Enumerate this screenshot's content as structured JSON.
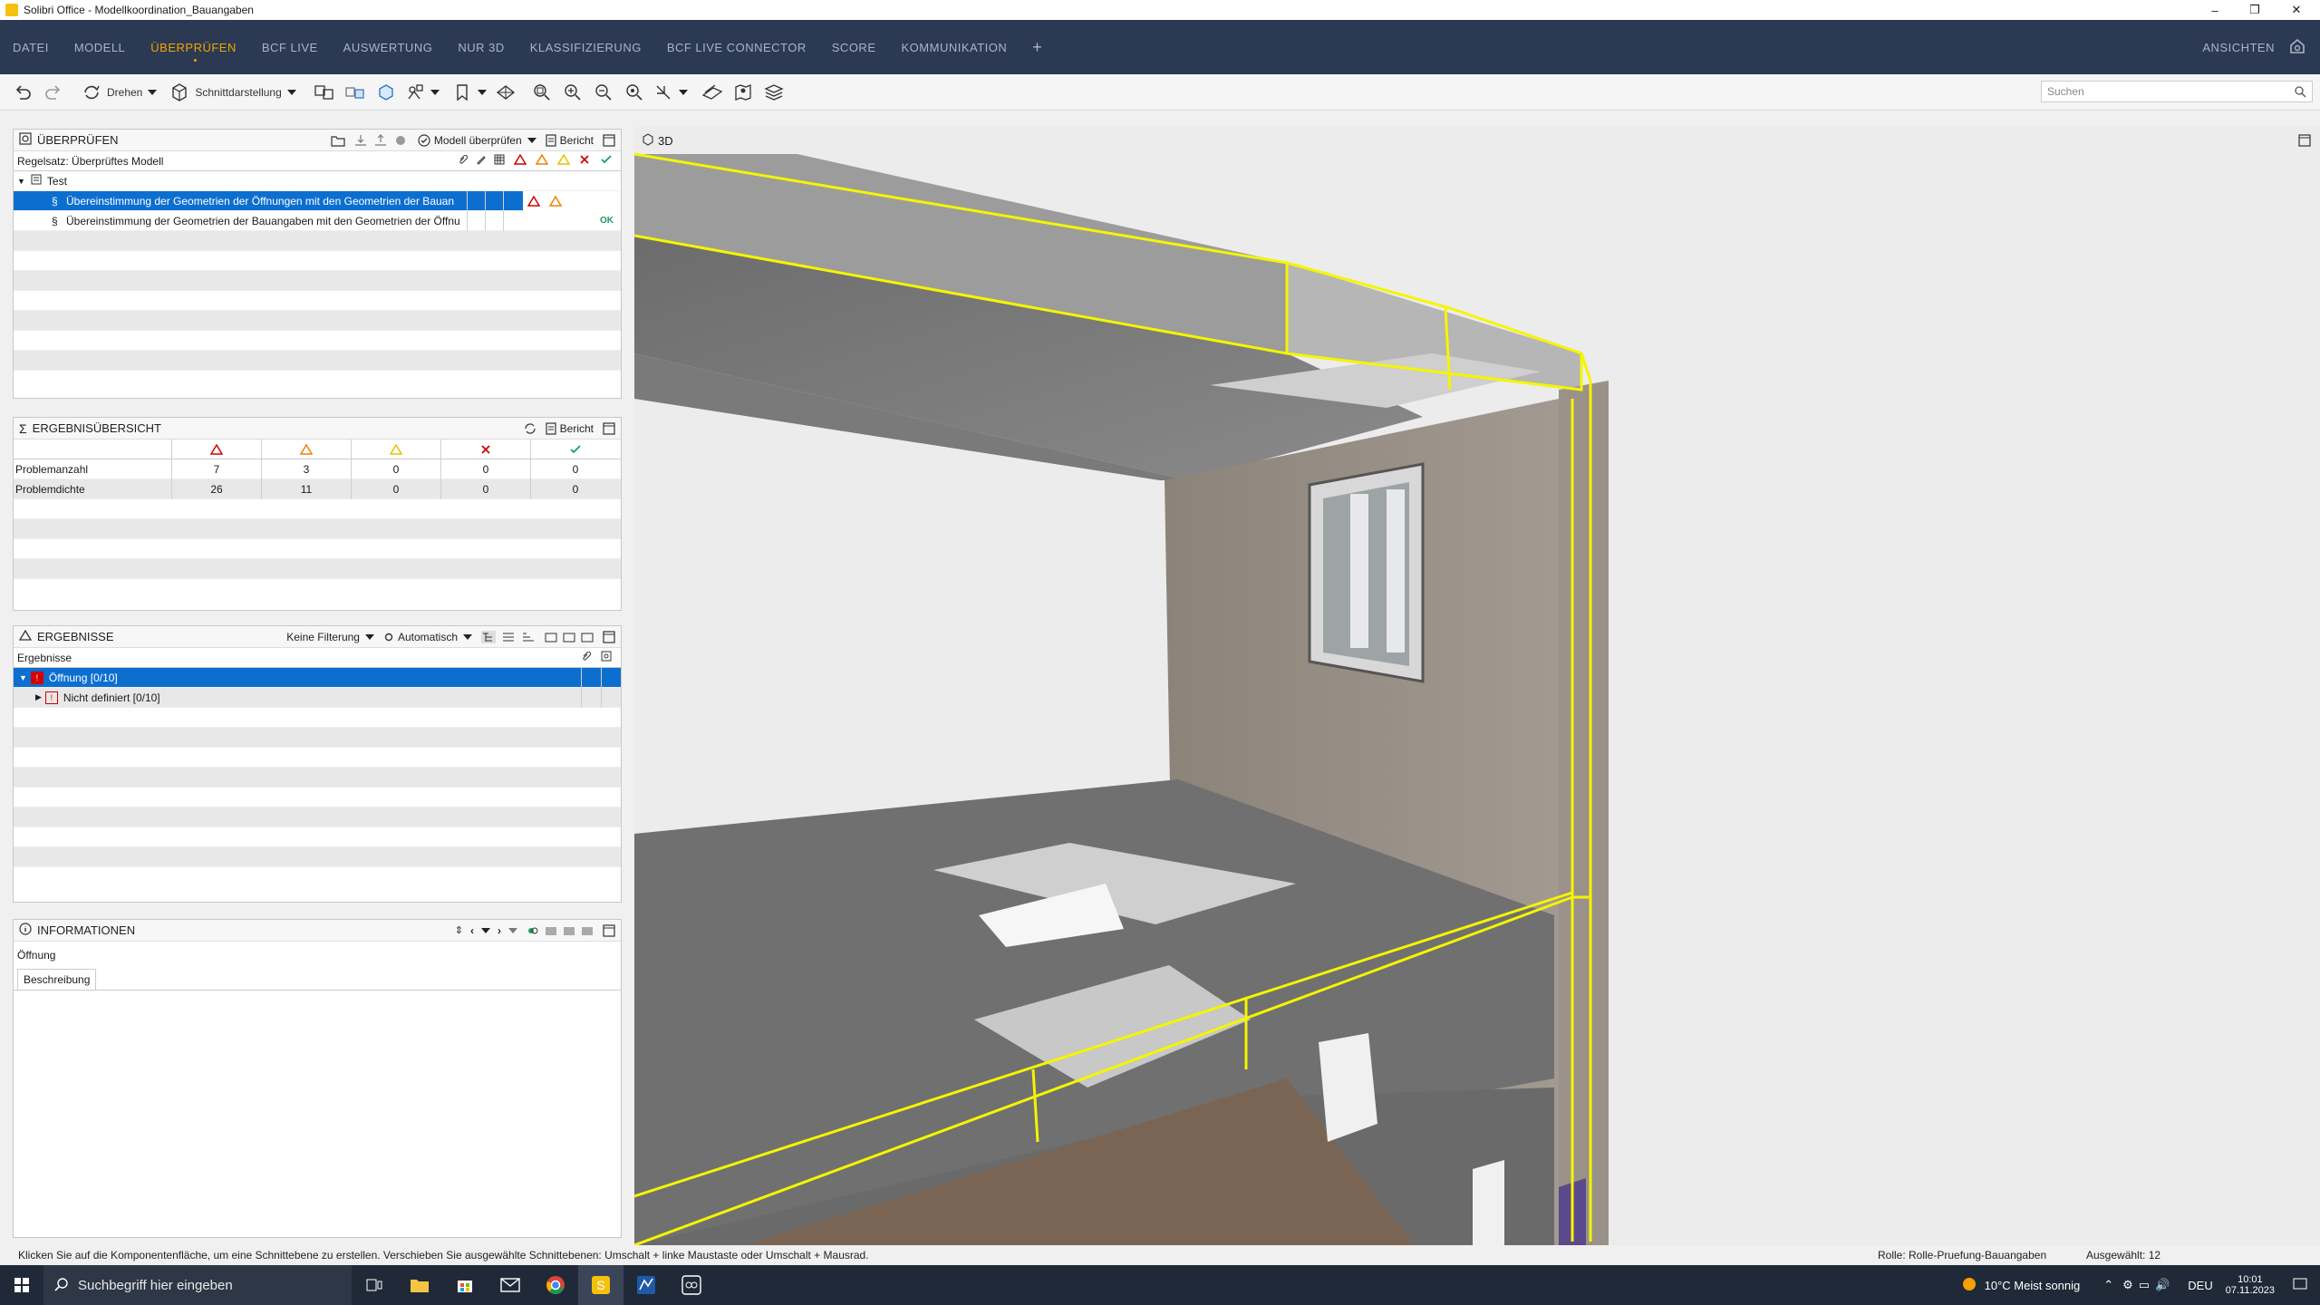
{
  "window": {
    "title": "Solibri Office - Modellkoordination_Bauangaben"
  },
  "menu": {
    "items": [
      "DATEI",
      "MODELL",
      "ÜBERPRÜFEN",
      "BCF LIVE",
      "AUSWERTUNG",
      "NUR 3D",
      "KLASSIFIZIERUNG",
      "BCF LIVE CONNECTOR",
      "SCORE",
      "KOMMUNIKATION"
    ],
    "active": "ÜBERPRÜFEN",
    "plus": "+",
    "right_label": "ANSICHTEN"
  },
  "toolbar": {
    "rotate_label": "Drehen",
    "section_label": "Schnittdarstellung",
    "search_placeholder": "Suchen"
  },
  "check_panel": {
    "title": "ÜBERPRÜFEN",
    "check_model_label": "Modell überprüfen",
    "report_label": "Bericht",
    "ruleset_label": "Regelsatz: Überprüftes Modell",
    "tree_root": "Test",
    "rules": [
      {
        "label": "Übereinstimmung der Geometrien der Öffnungen mit den Geometrien der Bauan",
        "result": "warn"
      },
      {
        "label": "Übereinstimmung der Geometrien der Bauangaben mit den Geometrien der Öffnu",
        "result": "OK"
      }
    ]
  },
  "summary_panel": {
    "title": "ERGEBNISÜBERSICHT",
    "report_label": "Bericht",
    "rows": [
      {
        "label": "Problemanzahl",
        "values": [
          "7",
          "3",
          "0",
          "0",
          "0"
        ]
      },
      {
        "label": "Problemdichte",
        "values": [
          "26",
          "11",
          "0",
          "0",
          "0"
        ]
      }
    ]
  },
  "results_panel": {
    "title": "ERGEBNISSE",
    "filter_label": "Keine Filterung",
    "auto_label": "Automatisch",
    "column_header": "Ergebnisse",
    "items": [
      {
        "label": "Öffnung [0/10]",
        "selected": true
      },
      {
        "label": "Nicht definiert [0/10]",
        "selected": false
      }
    ]
  },
  "info_panel": {
    "title": "INFORMATIONEN",
    "object_name": "Öffnung",
    "tab_label": "Beschreibung"
  },
  "viewport": {
    "title": "3D"
  },
  "status": {
    "hint": "Klicken Sie auf die Komponentenfläche, um eine Schnittebene zu erstellen. Verschieben Sie ausgewählte Schnittebenen: Umschalt + linke Maustaste oder Umschalt + Mausrad.",
    "role": "Rolle: Rolle-Pruefung-Bauangaben",
    "selected": "Ausgewählt: 12"
  },
  "taskbar": {
    "search_placeholder": "Suchbegriff hier eingeben",
    "weather": "10°C  Meist sonnig",
    "lang": "DEU",
    "time": "10:01",
    "date": "07.11.2023"
  },
  "colors": {
    "accent": "#f0a500",
    "selection": "#0c6fd0",
    "menubar": "#2b3a52",
    "highlight": "#f5f500"
  }
}
